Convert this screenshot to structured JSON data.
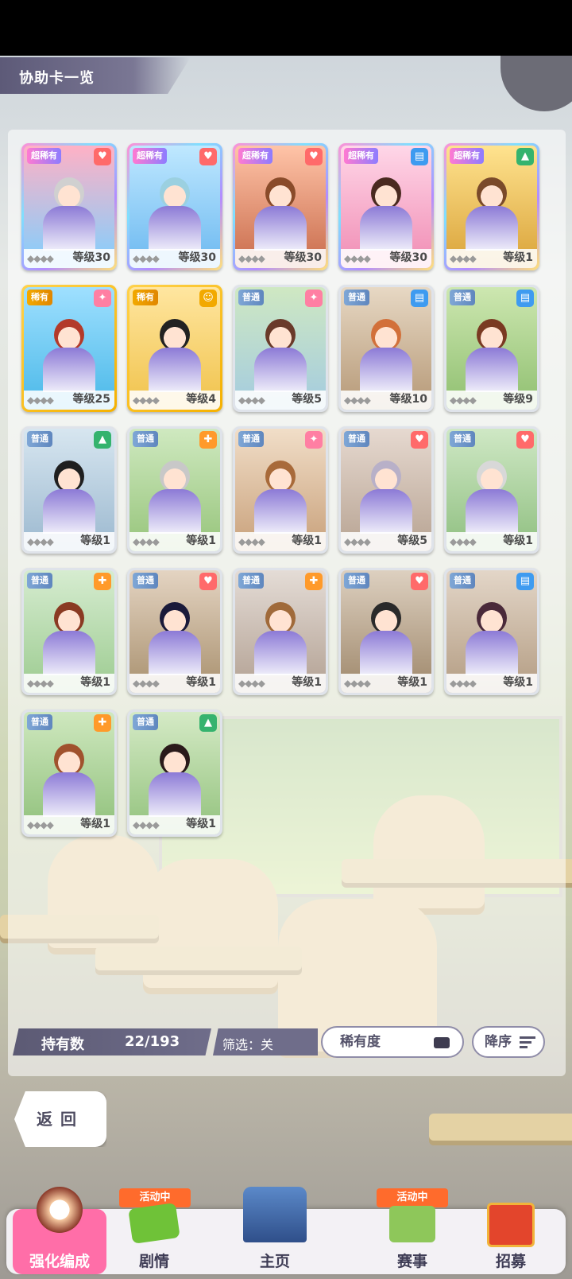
{
  "header": {
    "title": "协助卡一览"
  },
  "cards": [
    {
      "rarity": "超稀有",
      "type": "heart",
      "level": "等级30"
    },
    {
      "rarity": "超稀有",
      "type": "heart",
      "level": "等级30"
    },
    {
      "rarity": "超稀有",
      "type": "heart",
      "level": "等级30"
    },
    {
      "rarity": "超稀有",
      "type": "book",
      "level": "等级30"
    },
    {
      "rarity": "超稀有",
      "type": "cap",
      "level": "等级1"
    },
    {
      "rarity": "稀有",
      "type": "fire",
      "level": "等级25"
    },
    {
      "rarity": "稀有",
      "type": "friend",
      "level": "等级4"
    },
    {
      "rarity": "普通",
      "type": "fire",
      "level": "等级5"
    },
    {
      "rarity": "普通",
      "type": "book",
      "level": "等级10"
    },
    {
      "rarity": "普通",
      "type": "book",
      "level": "等级9"
    },
    {
      "rarity": "普通",
      "type": "cap",
      "level": "等级1"
    },
    {
      "rarity": "普通",
      "type": "power",
      "level": "等级1"
    },
    {
      "rarity": "普通",
      "type": "fire",
      "level": "等级1"
    },
    {
      "rarity": "普通",
      "type": "heart",
      "level": "等级5"
    },
    {
      "rarity": "普通",
      "type": "heart",
      "level": "等级1"
    },
    {
      "rarity": "普通",
      "type": "power",
      "level": "等级1"
    },
    {
      "rarity": "普通",
      "type": "heart",
      "level": "等级1"
    },
    {
      "rarity": "普通",
      "type": "power",
      "level": "等级1"
    },
    {
      "rarity": "普通",
      "type": "heart",
      "level": "等级1"
    },
    {
      "rarity": "普通",
      "type": "book",
      "level": "等级1"
    },
    {
      "rarity": "普通",
      "type": "power",
      "level": "等级1"
    },
    {
      "rarity": "普通",
      "type": "cap",
      "level": "等级1"
    }
  ],
  "footer": {
    "owned_label": "持有数",
    "owned_value": "22/193",
    "filter_label": "筛选：关",
    "rarity_sort": "稀有度",
    "order_sort": "降序"
  },
  "back_label": "返回",
  "nav": {
    "items": [
      {
        "label": "强化编成"
      },
      {
        "label": "剧情",
        "badge": "活动中"
      },
      {
        "label": "主页"
      },
      {
        "label": "赛事",
        "badge": "活动中"
      },
      {
        "label": "招募"
      }
    ]
  },
  "colors": {
    "heart": "#ff6a6a",
    "book": "#3e9bf0",
    "cap": "#35b36e",
    "fire": "#ff7fa3",
    "friend": "#f2a900",
    "power": "#ff9a2a",
    "accent": "#ff6ea8",
    "bar": "#6f6d8a"
  }
}
